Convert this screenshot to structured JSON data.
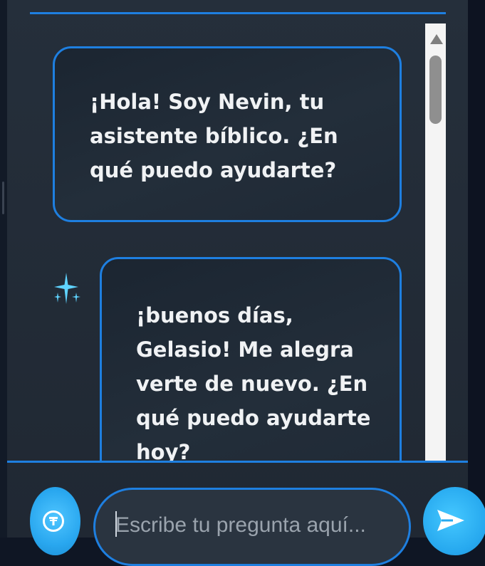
{
  "chat": {
    "messages": [
      {
        "text": "¡Hola! Soy Nevin, tu asistente bíblico. ¿En qué puedo ayudarte?"
      },
      {
        "text": "¡buenos días, Gelasio! Me alegra verte de nuevo. ¿En qué puedo ayudarte hoy?"
      }
    ]
  },
  "composer": {
    "placeholder": "Escribe tu pregunta aquí...",
    "value": ""
  },
  "icons": {
    "assistant": "sparkle-icon",
    "round_button": "circle-t-icon",
    "send": "send-icon"
  },
  "colors": {
    "accent": "#1e7fe0",
    "button": "#29a7ef",
    "sparkle": "#5fd3ff",
    "panel": "#232d39",
    "text": "#f0f2f4"
  }
}
